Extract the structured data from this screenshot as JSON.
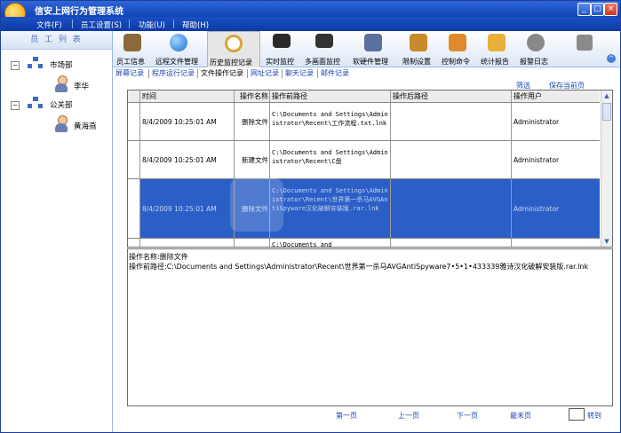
{
  "window": {
    "title": "信安上网行为管理系统"
  },
  "menu": [
    "文件(F)",
    "员工设置(S)",
    "功能(U)",
    "帮助(H)"
  ],
  "left_panel": {
    "header": "员 工 列 表",
    "departments": [
      {
        "name": "市场部",
        "employees": [
          "李华"
        ]
      },
      {
        "name": "公关部",
        "employees": [
          "黄海燕"
        ]
      }
    ]
  },
  "toolbar": [
    {
      "label": "员工信息",
      "icon": "employee-icon"
    },
    {
      "label": "远程文件管理",
      "icon": "globe-icon"
    },
    {
      "label": "历史监控记录",
      "icon": "magnifier-icon"
    },
    {
      "label": "实时监控",
      "icon": "monitor-icon"
    },
    {
      "label": "多画面监控",
      "icon": "multi-monitor-icon"
    },
    {
      "label": "软硬件管理",
      "icon": "hardware-icon"
    },
    {
      "label": "限制设置",
      "icon": "restriction-icon"
    },
    {
      "label": "控制命令",
      "icon": "control-icon"
    },
    {
      "label": "统计报告",
      "icon": "report-icon"
    },
    {
      "label": "报警日志",
      "icon": "alarm-icon"
    }
  ],
  "subtabs": [
    "屏幕记录",
    "程序运行记录",
    "文件操作记录",
    "网址记录",
    "聊天记录",
    "邮件记录"
  ],
  "actions": {
    "filter": "筛选",
    "save": "保存当前页"
  },
  "table": {
    "columns": [
      "时间",
      "操作名称",
      "操作前路径",
      "操作后路径",
      "操作用户"
    ],
    "rows": [
      {
        "time": "8/4/2009 10:25:01 AM",
        "op": "删除文件",
        "before": "C:\\Documents and Settings\\Administrator\\Recent\\工作流程.txt.lnk",
        "after": "",
        "user": "Administrator",
        "selected": false
      },
      {
        "time": "8/4/2009 10:25:01 AM",
        "op": "新建文件",
        "before": "C:\\Documents and Settings\\Administrator\\Recent\\C盘",
        "after": "",
        "user": "Administrator",
        "selected": false
      },
      {
        "time": "8/4/2009 10:25:01 AM",
        "op": "删除文件",
        "before": "C:\\Documents and Settings\\Administrator\\Recent\\世界第一杀马AVGAntiSpyware汉化破解安装版.rar.lnk",
        "after": "",
        "user": "Administrator",
        "selected": true
      },
      {
        "time": "",
        "op": "",
        "before": "C:\\Documents and",
        "after": "",
        "user": "",
        "selected": false
      }
    ]
  },
  "detail": {
    "line1": "操作名称:删除文件",
    "line2": "操作前路径:C:\\Documents and Settings\\Administrator\\Recent\\世界第一杀马AVGAntiSpyware7•5•1•433339雅诗汉化破解安装版.rar.lnk"
  },
  "pager": {
    "first": "第一页",
    "prev": "上一页",
    "next": "下一页",
    "last": "最末页",
    "jump": "转到"
  }
}
